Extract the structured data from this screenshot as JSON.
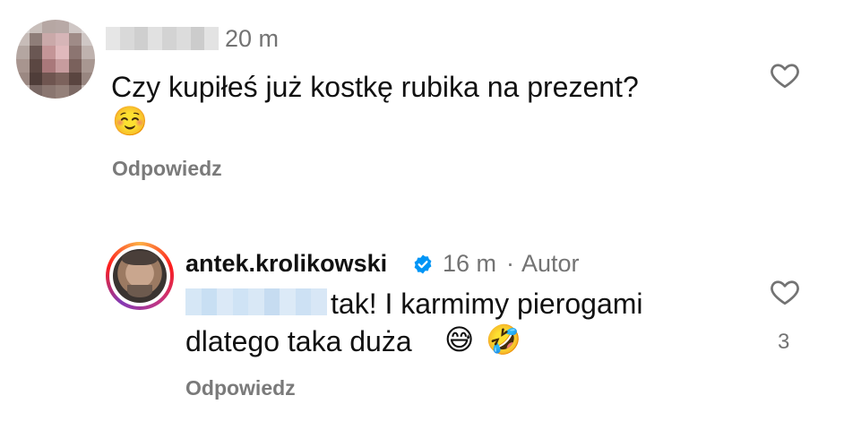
{
  "comment1": {
    "time": "20 m",
    "text_line1": "Czy kupiłeś już kostkę rubika na prezent?",
    "emoji": "☺️",
    "reply_label": "Odpowiedz"
  },
  "comment2": {
    "username": "antek.krolikowski",
    "time": "16 m",
    "separator": "·",
    "author_tag": "Autor",
    "text_line1": "tak! I karmimy pierogami",
    "text_line2": "dlatego taka duża",
    "emoji1": "😅",
    "emoji2": "🤣",
    "reply_label": "Odpowiedz",
    "like_count": "3"
  },
  "colors": {
    "secondary_text": "#737373",
    "verified_blue": "#0095f6",
    "mention_blue": "#cfe3f5"
  },
  "icons": [
    "heart-outline-icon",
    "verified-badge-icon"
  ]
}
